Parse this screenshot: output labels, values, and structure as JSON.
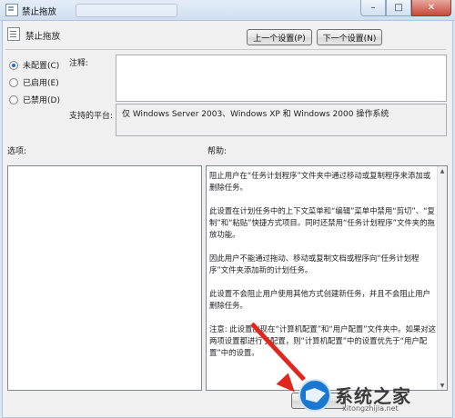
{
  "window": {
    "title": "禁止拖放",
    "controls": {
      "minimize": "–",
      "maximize": "□",
      "close": "✕"
    }
  },
  "header": {
    "policy_name": "禁止拖放"
  },
  "nav": {
    "prev_label": "上一个设置(P)",
    "next_label": "下一个设置(N)"
  },
  "state_options": [
    {
      "label": "未配置(C)",
      "selected": true
    },
    {
      "label": "已启用(E)",
      "selected": false
    },
    {
      "label": "已禁用(D)",
      "selected": false
    }
  ],
  "comment": {
    "label": "注释:",
    "value": ""
  },
  "platform": {
    "label": "支持的平台:",
    "value": "仅 Windows Server 2003、Windows XP 和 Windows 2000 操作系统"
  },
  "options": {
    "label": "选项:"
  },
  "help": {
    "label": "帮助:",
    "paragraphs": [
      "阻止用户在“任务计划程序”文件夹中通过移动或复制程序来添加或删除任务。",
      "此设置在计划任务中的上下文菜单和“编辑”菜单中禁用“剪切”、“复制”和“粘贴”快捷方式项目。同时还禁用“任务计划程序”文件夹的拖放功能。",
      "因此用户不能通过拖动、移动或复制文档或程序向“任务计划程序”文件夹添加新的计划任务。",
      "此设置不会阻止用户使用其他方式创建新任务，并且不会阻止用户删除任务。",
      "注意: 此设置出现在“计算机配置”和“用户配置”文件夹中。如果对这两项设置都进行了配置，则“计算机配置”中的设置优先于“用户配置”中的设置。"
    ]
  },
  "watermark": {
    "brand": "系统之家",
    "url": "xitongzhijia.net"
  },
  "colors": {
    "arrow": "#e0261f",
    "selected_radio": "#2a6bc7"
  }
}
